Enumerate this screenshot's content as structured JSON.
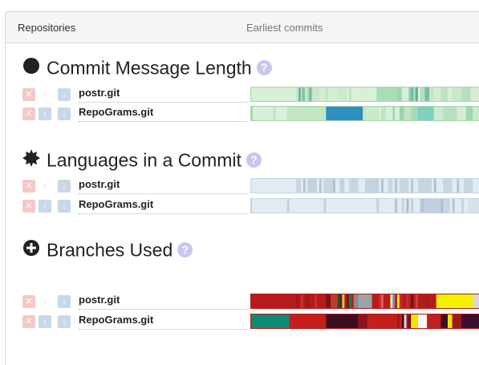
{
  "header": {
    "repositories_label": "Repositories",
    "earliest_label": "Earliest commits"
  },
  "sections": [
    {
      "title": "Commit Message Length",
      "icon": "filled-circle-icon",
      "help": "?",
      "rows": [
        {
          "repo": "postr.git",
          "base": "#d8efd8",
          "border": "#a8d8a8",
          "stripes": [
            [
              0.2,
              0.26,
              "#cbe8cb"
            ],
            [
              0.21,
              0.212,
              "#aadcc0"
            ],
            [
              0.205,
              0.22,
              "#b9e3c6"
            ],
            [
              0.21,
              0.215,
              "#8ccab0"
            ],
            [
              0.212,
              0.214,
              "#6bb5a3"
            ],
            [
              0.215,
              0.218,
              "#55a59a"
            ],
            [
              0.22,
              0.24,
              "#b7e0c0"
            ],
            [
              0.225,
              0.23,
              "#7fc2ae"
            ],
            [
              0.232,
              0.235,
              "#5aa99b"
            ],
            [
              0.25,
              0.27,
              "#9cd4b4"
            ],
            [
              0.26,
              0.262,
              "#4c9c93"
            ],
            [
              0.27,
              0.3,
              "#c7e7c7"
            ],
            [
              0.3,
              0.38,
              "#d2edd2"
            ],
            [
              0.33,
              0.335,
              "#b0dcbc"
            ],
            [
              0.38,
              0.42,
              "#cbe9cb"
            ],
            [
              0.43,
              0.44,
              "#bfe4c3"
            ],
            [
              0.55,
              0.64,
              "#abdcb5"
            ],
            [
              0.64,
              0.66,
              "#9fd4b1"
            ],
            [
              0.66,
              0.69,
              "#d6efd6"
            ],
            [
              0.69,
              0.7,
              "#8fcfb5"
            ],
            [
              0.7,
              0.71,
              "#6ab8a5"
            ],
            [
              0.71,
              0.72,
              "#a6d8b8"
            ],
            [
              0.72,
              0.73,
              "#5fae9f"
            ],
            [
              0.74,
              0.76,
              "#b6e0c0"
            ],
            [
              0.76,
              0.78,
              "#74bfaa"
            ],
            [
              0.78,
              0.8,
              "#c4e6c7"
            ],
            [
              0.8,
              0.83,
              "#d4eed4"
            ],
            [
              0.83,
              0.86,
              "#bde3c4"
            ],
            [
              0.86,
              0.88,
              "#d5eed5"
            ],
            [
              0.88,
              0.92,
              "#c8e8c8"
            ],
            [
              0.92,
              0.96,
              "#b5dfbf"
            ],
            [
              0.96,
              1.0,
              "#d4edd4"
            ]
          ]
        },
        {
          "repo": "RepoGrams.git",
          "base": "#d8efd8",
          "border": "#a8d8a8",
          "stripes": [
            [
              0.0,
              0.01,
              "#a7d9b5"
            ],
            [
              0.1,
              0.11,
              "#bfe4c3"
            ],
            [
              0.16,
              0.33,
              "#c2e6c4"
            ],
            [
              0.33,
              0.49,
              "#2e8fc0"
            ],
            [
              0.49,
              0.5,
              "#c2e6c4"
            ],
            [
              0.5,
              0.56,
              "#cbe9cb"
            ],
            [
              0.57,
              0.59,
              "#bfe4c3"
            ],
            [
              0.62,
              0.63,
              "#a5d8b6"
            ],
            [
              0.65,
              0.67,
              "#9bd3b1"
            ],
            [
              0.67,
              0.7,
              "#bfe4c3"
            ],
            [
              0.7,
              0.73,
              "#a6d9b7"
            ],
            [
              0.73,
              0.8,
              "#7fcfc3"
            ],
            [
              0.8,
              0.84,
              "#cde9cd"
            ],
            [
              0.84,
              0.9,
              "#b7e0c0"
            ],
            [
              0.9,
              0.94,
              "#d4edd4"
            ],
            [
              0.94,
              0.97,
              "#a2d6b5"
            ],
            [
              0.97,
              1.0,
              "#cde9cd"
            ]
          ]
        }
      ]
    },
    {
      "title": "Languages in a Commit",
      "icon": "gear-burst-icon",
      "help": "?",
      "rows": [
        {
          "repo": "postr.git",
          "base": "#e0ebf3",
          "border": "#c5d6e3",
          "stripes": [
            [
              0.2,
              0.22,
              "#c9d6e1"
            ],
            [
              0.23,
              0.24,
              "#b4c4d2"
            ],
            [
              0.25,
              0.29,
              "#c3d1dd"
            ],
            [
              0.3,
              0.31,
              "#b8c7d4"
            ],
            [
              0.32,
              0.36,
              "#c9d5e0"
            ],
            [
              0.36,
              0.37,
              "#b1c2cf"
            ],
            [
              0.39,
              0.41,
              "#c4d2de"
            ],
            [
              0.43,
              0.47,
              "#c9d5e0"
            ],
            [
              0.5,
              0.56,
              "#c5d3df"
            ],
            [
              0.57,
              0.58,
              "#b6c5d2"
            ],
            [
              0.6,
              0.62,
              "#c9d5e0"
            ],
            [
              0.63,
              0.64,
              "#b3c3d0"
            ],
            [
              0.65,
              0.69,
              "#c9d5e0"
            ],
            [
              0.7,
              0.71,
              "#b6c6d3"
            ],
            [
              0.73,
              0.79,
              "#c8d4df"
            ],
            [
              0.8,
              0.81,
              "#b0c1ce"
            ],
            [
              0.84,
              0.88,
              "#c9d5e0"
            ],
            [
              0.9,
              0.91,
              "#b6c5d2"
            ],
            [
              0.93,
              0.97,
              "#c9d5e0"
            ]
          ]
        },
        {
          "repo": "RepoGrams.git",
          "base": "#e0ebf3",
          "border": "#c5d6e3",
          "stripes": [
            [
              0.0,
              0.005,
              "#8fa7bb"
            ],
            [
              0.16,
              0.17,
              "#c4d2de"
            ],
            [
              0.32,
              0.33,
              "#c4d2de"
            ],
            [
              0.55,
              0.56,
              "#c4d2de"
            ],
            [
              0.63,
              0.64,
              "#b3c3d0"
            ],
            [
              0.66,
              0.67,
              "#c4d2de"
            ],
            [
              0.68,
              0.69,
              "#aabbca"
            ],
            [
              0.7,
              0.71,
              "#c4d2de"
            ],
            [
              0.74,
              0.76,
              "#b8c7d4"
            ],
            [
              0.76,
              0.83,
              "#bfd0e2"
            ],
            [
              0.83,
              0.84,
              "#a9bccd"
            ],
            [
              0.84,
              0.87,
              "#c9d6e1"
            ],
            [
              0.88,
              0.89,
              "#b6c5d2"
            ],
            [
              0.92,
              0.93,
              "#c4d2de"
            ],
            [
              0.95,
              1.0,
              "#d4e0ea"
            ]
          ]
        }
      ]
    },
    {
      "title": "Branches Used",
      "icon": "plus-circle-icon",
      "help": "?",
      "rows": [
        {
          "repo": "postr.git",
          "base": "#b81b1b",
          "border": "#b81b1b",
          "stripes": [
            [
              0.2,
              0.21,
              "#a01818"
            ],
            [
              0.22,
              0.23,
              "#c9302c"
            ],
            [
              0.24,
              0.26,
              "#9e1a1a"
            ],
            [
              0.28,
              0.29,
              "#c9302c"
            ],
            [
              0.33,
              0.35,
              "#7a1414"
            ],
            [
              0.35,
              0.38,
              "#c0392b"
            ],
            [
              0.38,
              0.39,
              "#1f5a1f"
            ],
            [
              0.39,
              0.4,
              "#5a1a3a"
            ],
            [
              0.4,
              0.41,
              "#e8c82c"
            ],
            [
              0.42,
              0.43,
              "#6b1a1a"
            ],
            [
              0.43,
              0.44,
              "#1f7a4f"
            ],
            [
              0.45,
              0.47,
              "#8a8a8a"
            ],
            [
              0.47,
              0.53,
              "#9aa5a8"
            ],
            [
              0.56,
              0.57,
              "#c9302c"
            ],
            [
              0.57,
              0.58,
              "#e05a5a"
            ],
            [
              0.61,
              0.62,
              "#f5f5a0"
            ],
            [
              0.62,
              0.63,
              "#7f8fbf"
            ],
            [
              0.64,
              0.65,
              "#e8e820"
            ],
            [
              0.65,
              0.66,
              "#bf3030"
            ],
            [
              0.68,
              0.69,
              "#c73030"
            ],
            [
              0.7,
              0.71,
              "#6a1414"
            ],
            [
              0.72,
              0.73,
              "#cf3f3f"
            ],
            [
              0.76,
              0.78,
              "#a41c1c"
            ],
            [
              0.81,
              0.97,
              "#f2f200"
            ],
            [
              0.97,
              1.0,
              "#d8d8d8"
            ]
          ]
        },
        {
          "repo": "RepoGrams.git",
          "base": "#b81b1b",
          "border": "#b81b1b",
          "stripes": [
            [
              0.0,
              0.17,
              "#0f8a74"
            ],
            [
              0.17,
              0.2,
              "#c02020"
            ],
            [
              0.2,
              0.33,
              "#c51c1c"
            ],
            [
              0.33,
              0.47,
              "#3a0f1f"
            ],
            [
              0.47,
              0.51,
              "#8a1520"
            ],
            [
              0.51,
              0.55,
              "#c02020"
            ],
            [
              0.55,
              0.64,
              "#c51c1c"
            ],
            [
              0.64,
              0.65,
              "#a21818"
            ],
            [
              0.65,
              0.66,
              "#c02020"
            ],
            [
              0.66,
              0.67,
              "#3a0f1f"
            ],
            [
              0.67,
              0.68,
              "#d7d7d7"
            ],
            [
              0.68,
              0.69,
              "#a21818"
            ],
            [
              0.69,
              0.7,
              "#5a1428"
            ],
            [
              0.7,
              0.73,
              "#f5e200"
            ],
            [
              0.73,
              0.77,
              "#f8f8f8"
            ],
            [
              0.77,
              0.83,
              "#c02020"
            ],
            [
              0.83,
              0.86,
              "#3a0f1f"
            ],
            [
              0.86,
              0.88,
              "#f5e200"
            ],
            [
              0.88,
              0.92,
              "#9a1a1a"
            ],
            [
              0.92,
              1.0,
              "#3a0f2f"
            ]
          ]
        }
      ]
    }
  ]
}
